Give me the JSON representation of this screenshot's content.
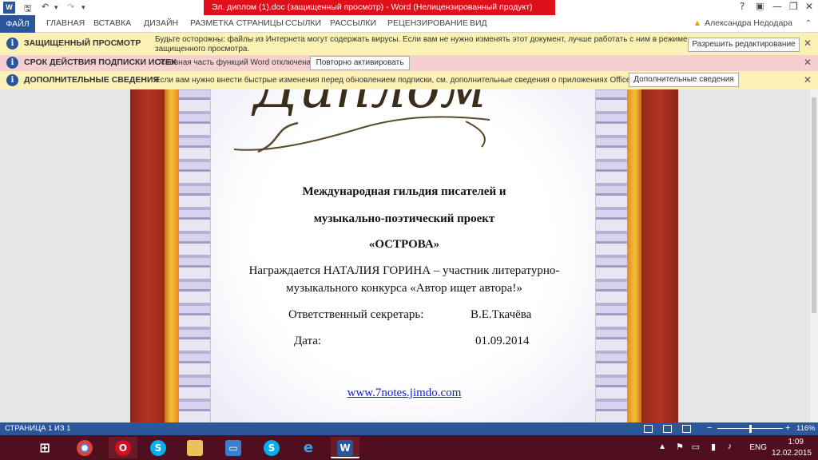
{
  "titlebar": {
    "app_icon": "W",
    "title": "Эл. диплом (1).doc (защищенный просмотр) -  Word (Нелицензированный продукт)",
    "controls": [
      "?",
      "▣",
      "—",
      "❐",
      "✕"
    ]
  },
  "ribbon": {
    "file_tab": "ФАЙЛ",
    "tabs": [
      "ГЛАВНАЯ",
      "ВСТАВКА",
      "ДИЗАЙН",
      "РАЗМЕТКА СТРАНИЦЫ",
      "ССЫЛКИ",
      "РАССЫЛКИ",
      "РЕЦЕНЗИРОВАНИЕ",
      "ВИД"
    ],
    "account": "Александра Недодара"
  },
  "bars": {
    "protected": {
      "title": "ЗАЩИЩЕННЫЙ ПРОСМОТР",
      "message_1": "Будьте осторожны: файлы из Интернета могут содержать вирусы. Если вам не нужно изменять этот документ, лучше работать с ним в режиме",
      "message_2": "защищенного просмотра.",
      "button": "Разрешить редактирование"
    },
    "subscription": {
      "title": "СРОК ДЕЙСТВИЯ ПОДПИСКИ ИСТЕК",
      "message": "Основная часть функций Word отключена.",
      "button": "Повторно активировать"
    },
    "info": {
      "title": "ДОПОЛНИТЕЛЬНЫЕ СВЕДЕНИЯ",
      "message": "Если вам нужно внести быстрые изменения перед обновлением подписки, см. дополнительные сведения о приложениях Office Web Apps.",
      "button": "Дополнительные сведения"
    }
  },
  "document": {
    "line1": "Международная гильдия писателей и",
    "line2": "музыкально-поэтический проект",
    "line3": "«ОСТРОВА»",
    "line4": "Награждается НАТАЛИЯ ГОРИНА – участник литературно-",
    "line5": "музыкального конкурса «Автор ищет автора!»",
    "secretary_label": "Ответственный секретарь:",
    "secretary_name": "В.Е.Ткачёва",
    "date_label": "Дата:",
    "date_value": "01.09.2014",
    "link": "www.7notes.jimdo.com",
    "script_heading": "Диплом"
  },
  "statusbar": {
    "page": "СТРАНИЦА 1 ИЗ 1",
    "zoom": "116%"
  },
  "taskbar": {
    "lang": "ENG",
    "time": "1:09",
    "date": "12.02.2015",
    "apps": [
      "start-icon",
      "chrome-icon",
      "opera-icon",
      "skype-icon",
      "file-explorer-icon",
      "remote-desktop-icon",
      "skype-icon",
      "internet-explorer-icon",
      "word-icon"
    ]
  },
  "colors": {
    "word_blue": "#2b579a",
    "warning_bar": "#fcf1b4",
    "error_bar": "#f6cfd0",
    "title_accent": "#e0101b",
    "taskbar": "#4f0f1f"
  }
}
